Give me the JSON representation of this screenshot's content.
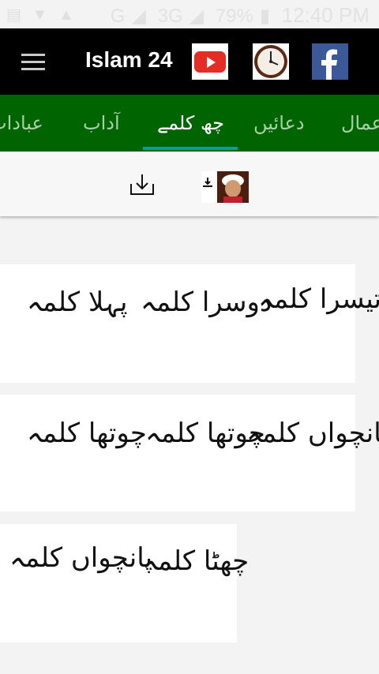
{
  "status_bar": {
    "left_icons": [
      "notification-icon",
      "wifi-icon",
      "drive-icon"
    ],
    "network": "G",
    "network2": "3G",
    "battery": "79%",
    "time": "12:40 PM"
  },
  "app_bar": {
    "title": "Islam 24",
    "icons": [
      "youtube-icon",
      "clock-icon",
      "facebook-icon"
    ]
  },
  "tabs": [
    {
      "label": "عمال",
      "active": false
    },
    {
      "label": "دعائیں",
      "active": false
    },
    {
      "label": "چھ کلمے",
      "active": true
    },
    {
      "label": "آداب",
      "active": false
    },
    {
      "label": "عبادات",
      "active": false
    }
  ],
  "grid": {
    "row1": [
      "تیسرا کلمہ",
      "دوسرا کلمہ",
      "پہلا کلمہ"
    ],
    "row2": [
      "پانچواں کلمہ",
      "چوتھا کلمہ",
      "چوتھا کلمہ"
    ],
    "row3": [
      "چھٹا کلمہ",
      "پانچواں کلمہ"
    ]
  },
  "colors": {
    "appbar": "#000000",
    "tabbar": "#006400",
    "indicator": "#00a0a8"
  }
}
